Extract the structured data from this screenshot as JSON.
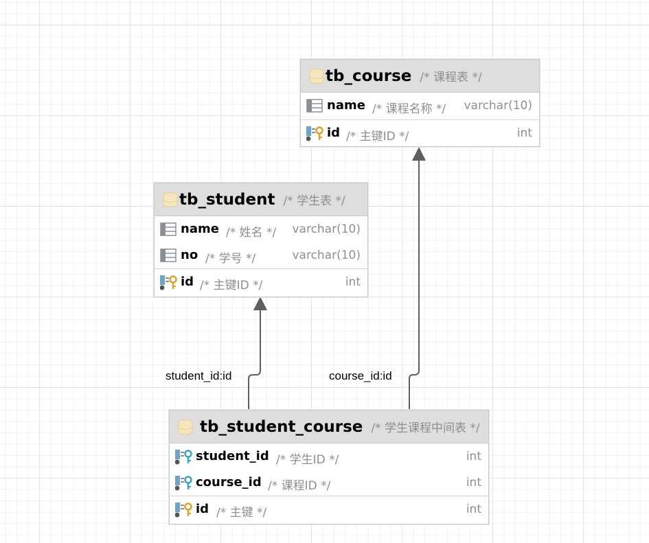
{
  "tables": {
    "course": {
      "name": "tb_course",
      "comment": "/* 课程表 */",
      "fields": [
        {
          "name": "name",
          "comment": "/* 课程名称 */",
          "type": "varchar(10)"
        },
        {
          "name": "id",
          "comment": "/* 主键ID */",
          "type": "int"
        }
      ]
    },
    "student": {
      "name": "tb_student",
      "comment": "/* 学生表 */",
      "fields": [
        {
          "name": "name",
          "comment": "/* 姓名 */",
          "type": "varchar(10)"
        },
        {
          "name": "no",
          "comment": "/* 学号 */",
          "type": "varchar(10)"
        },
        {
          "name": "id",
          "comment": "/* 主键ID */",
          "type": "int"
        }
      ]
    },
    "student_course": {
      "name": "tb_student_course",
      "comment": "/* 学生课程中间表 */",
      "fields": [
        {
          "name": "student_id",
          "comment": "/* 学生ID */",
          "type": "int"
        },
        {
          "name": "course_id",
          "comment": "/* 课程ID */",
          "type": "int"
        },
        {
          "name": "id",
          "comment": "/* 主键 */",
          "type": "int"
        }
      ]
    }
  },
  "relations": [
    {
      "label": "student_id:id",
      "from": "tb_student_course.student_id",
      "to": "tb_student.id"
    },
    {
      "label": "course_id:id",
      "from": "tb_student_course.course_id",
      "to": "tb_course.id"
    }
  ],
  "icons": {
    "table": "table-icon",
    "column": "column-icon",
    "primary_key": "primary-key-icon",
    "foreign_key": "foreign-key-icon"
  },
  "colors": {
    "header_bg": "#dedede",
    "pk_key": "#e0a030",
    "fk_key": "#3aa3c6",
    "edge": "#5a5a5a"
  }
}
